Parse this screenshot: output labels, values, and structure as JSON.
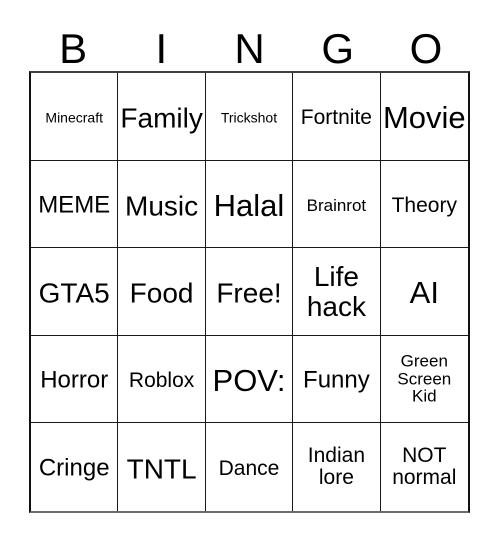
{
  "card": {
    "header_letters": [
      "B",
      "I",
      "N",
      "G",
      "O"
    ],
    "columns": 5,
    "rows": 5,
    "border_color": "#1a1a1a",
    "background_color": "#ffffff",
    "text_color": "#000000",
    "cells": [
      {
        "text": "Minecraft",
        "lines": 1,
        "size": "fs-xs"
      },
      {
        "text": "Family",
        "lines": 1,
        "size": "fs-xl"
      },
      {
        "text": "Trickshot",
        "lines": 1,
        "size": "fs-xs"
      },
      {
        "text": "Fortnite",
        "lines": 1,
        "size": "fs-md"
      },
      {
        "text": "Movie",
        "lines": 1,
        "size": "fs-xxl"
      },
      {
        "text": "MEME",
        "lines": 1,
        "size": "fs-lg"
      },
      {
        "text": "Music",
        "lines": 1,
        "size": "fs-xl"
      },
      {
        "text": "Halal",
        "lines": 1,
        "size": "fs-xxl"
      },
      {
        "text": "Brainrot",
        "lines": 1,
        "size": "fs-sm"
      },
      {
        "text": "Theory",
        "lines": 1,
        "size": "fs-md"
      },
      {
        "text": "GTA5",
        "lines": 1,
        "size": "fs-xl"
      },
      {
        "text": "Food",
        "lines": 1,
        "size": "fs-xl"
      },
      {
        "text": "Free!",
        "lines": 1,
        "size": "fs-xl"
      },
      {
        "text": "Life\nhack",
        "lines": 2,
        "size": "fs-xl"
      },
      {
        "text": "AI",
        "lines": 1,
        "size": "fs-xxl"
      },
      {
        "text": "Horror",
        "lines": 1,
        "size": "fs-lg"
      },
      {
        "text": "Roblox",
        "lines": 1,
        "size": "fs-md"
      },
      {
        "text": "POV:",
        "lines": 1,
        "size": "fs-xxl"
      },
      {
        "text": "Funny",
        "lines": 1,
        "size": "fs-lg"
      },
      {
        "text": "Green\nScreen\nKid",
        "lines": 3,
        "size": "fs-sm"
      },
      {
        "text": "Cringe",
        "lines": 1,
        "size": "fs-lg"
      },
      {
        "text": "TNTL",
        "lines": 1,
        "size": "fs-xl"
      },
      {
        "text": "Dance",
        "lines": 1,
        "size": "fs-md"
      },
      {
        "text": "Indian\nlore",
        "lines": 2,
        "size": "fs-md"
      },
      {
        "text": "NOT\nnormal",
        "lines": 2,
        "size": "fs-md"
      }
    ]
  }
}
